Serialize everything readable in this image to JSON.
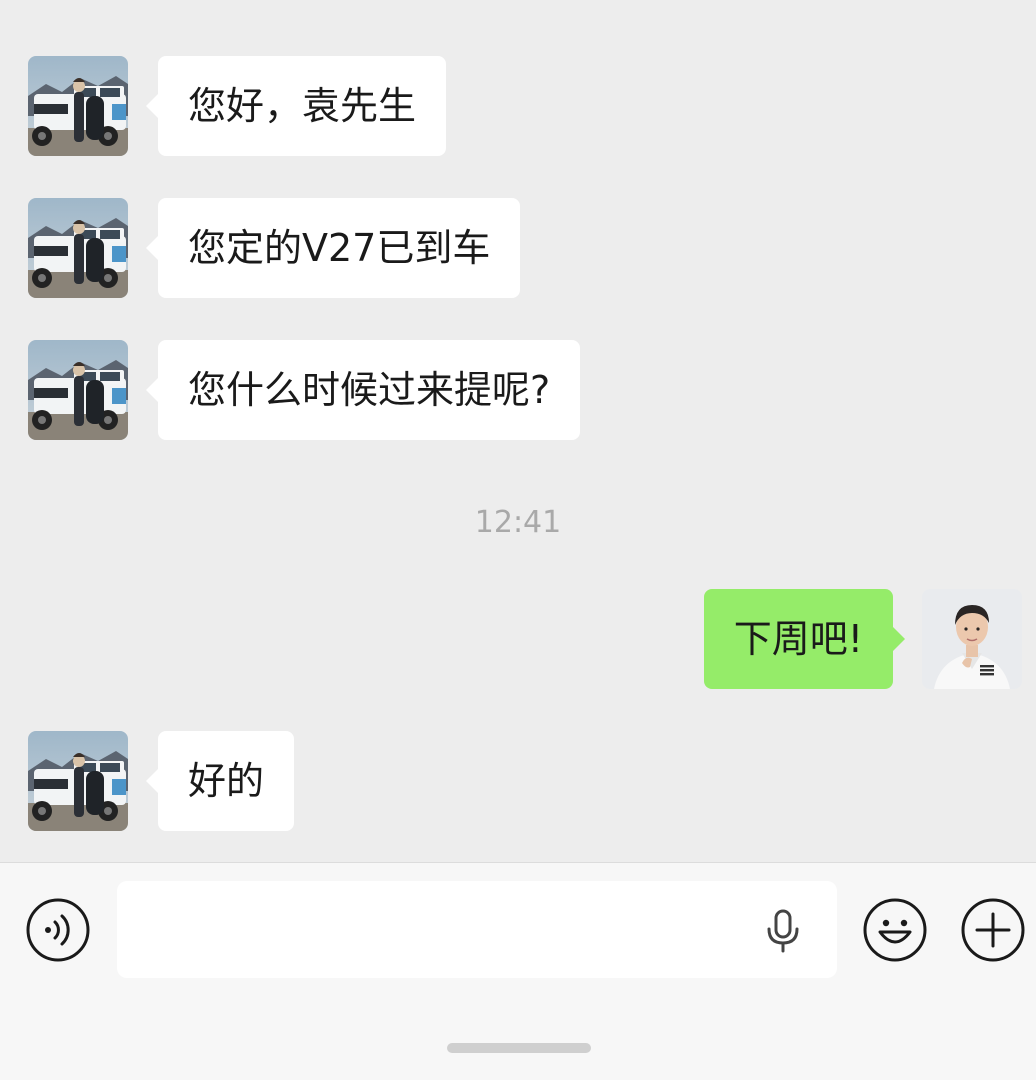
{
  "chat": {
    "timestamps": {
      "mid": "12:41"
    },
    "messages": [
      {
        "sender": "contact",
        "text": "您好，袁先生",
        "avatar": "suv-photo-avatar"
      },
      {
        "sender": "contact",
        "text": "您定的V27已到车",
        "avatar": "suv-photo-avatar"
      },
      {
        "sender": "contact",
        "text": "您什么时候过来提呢?",
        "avatar": "suv-photo-avatar"
      },
      {
        "sender": "me",
        "text": "下周吧!",
        "avatar": "man-white-shirt-avatar"
      },
      {
        "sender": "contact",
        "text": "好的",
        "avatar": "suv-photo-avatar"
      }
    ]
  },
  "composer": {
    "input_value": "",
    "icons": {
      "voice": "voice-icon",
      "mic": "microphone-icon",
      "emoji": "emoji-icon",
      "plus": "plus-icon"
    }
  },
  "colors": {
    "background": "#ededed",
    "incoming_bubble": "#ffffff",
    "outgoing_bubble": "#95ec69",
    "timestamp": "#a9a9a9"
  }
}
